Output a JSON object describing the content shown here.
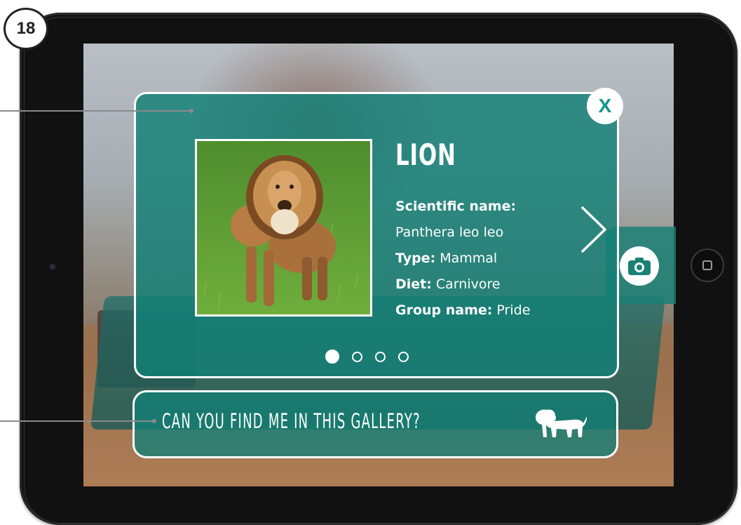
{
  "step": {
    "number": "18"
  },
  "card": {
    "title": "LION",
    "close_label": "X",
    "photo_alt": "Lion standing on grass",
    "facts": [
      {
        "label": "Scientific name:",
        "value": ""
      },
      {
        "label": "",
        "value": "Panthera leo leo"
      },
      {
        "label": "Type:",
        "value": " Mammal"
      },
      {
        "label": "Diet:",
        "value": " Carnivore"
      },
      {
        "label": "Group name:",
        "value": " Pride"
      }
    ],
    "pager": {
      "total": 4,
      "current": 1
    }
  },
  "banner": {
    "text": "CAN YOU FIND ME IN THIS GALLERY?"
  },
  "icons": {
    "close": "close-icon",
    "next": "chevron-right-icon",
    "camera": "camera-icon",
    "lion": "lion-silhouette-icon"
  },
  "colors": {
    "accent": "#14958a",
    "card_fill": "#128076",
    "text": "#ffffff",
    "device": "#111111"
  }
}
